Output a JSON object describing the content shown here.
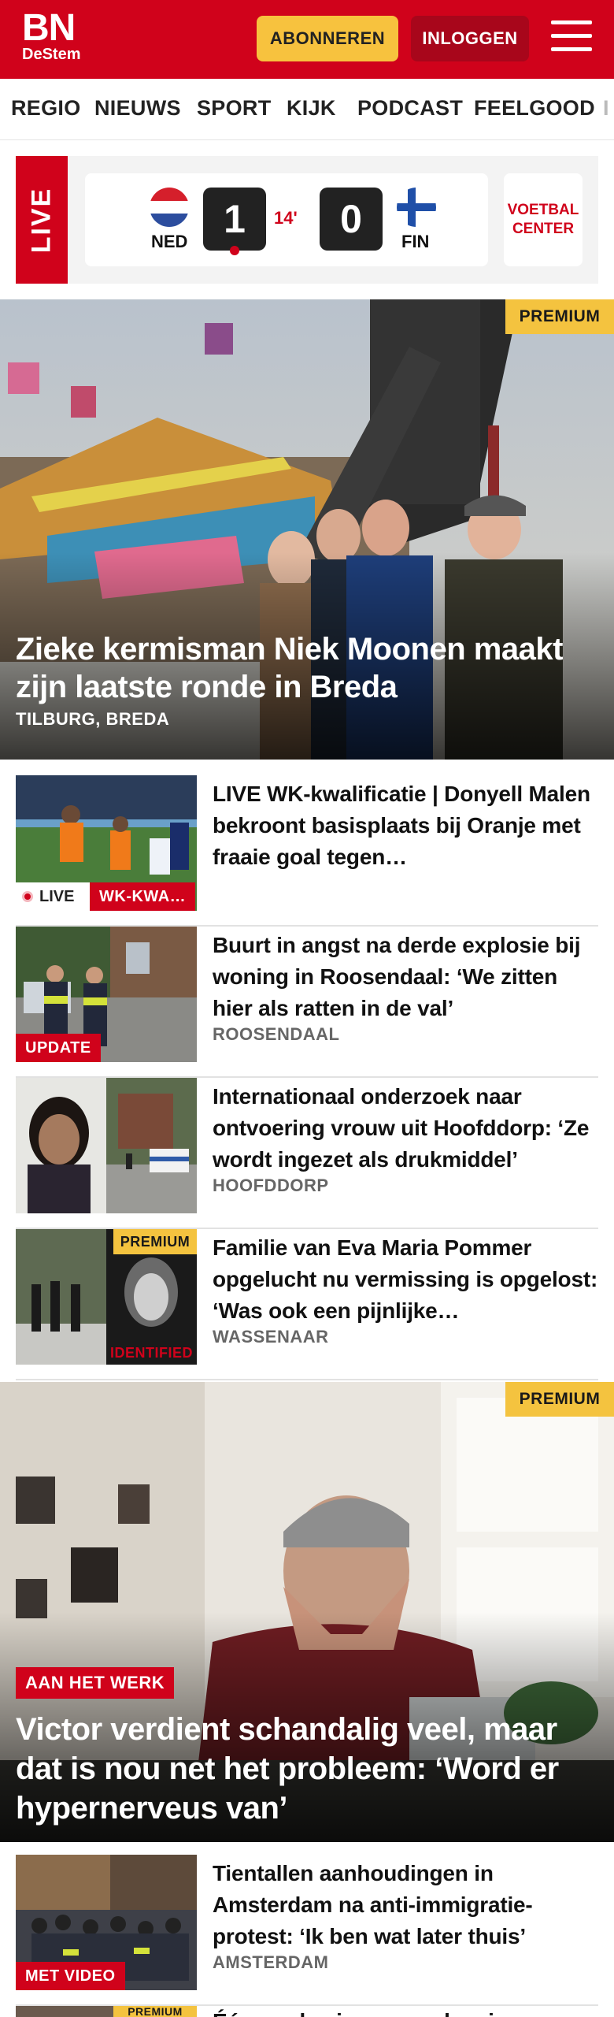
{
  "header": {
    "logo_top": "BN",
    "logo_bottom": "DeStem",
    "subscribe_label": "ABONNEREN",
    "login_label": "INLOGGEN",
    "colors": {
      "brand": "#d0021b",
      "subscribe": "#f7c23e",
      "login": "#a8061b"
    }
  },
  "nav": {
    "items": [
      {
        "label": "REGIO"
      },
      {
        "label": "NIEUWS"
      },
      {
        "label": "SPORT"
      },
      {
        "label": "KIJK"
      },
      {
        "label": "PODCAST"
      },
      {
        "label": "FEELGOOD"
      },
      {
        "label": "I"
      }
    ]
  },
  "live_match": {
    "tag": "LIVE",
    "home": {
      "code": "NED",
      "score": "1"
    },
    "away": {
      "code": "FIN",
      "score": "0"
    },
    "minute": "14'",
    "voetbal_center": "VOETBAL CENTER"
  },
  "hero": {
    "badge": "PREMIUM",
    "title": "Zieke kermisman Niek Moonen maakt zijn laatste ronde in Breda",
    "location": "TILBURG, BREDA"
  },
  "articles": [
    {
      "title": "LIVE WK-kwalificatie | Donyell Malen bekroont basisplaats bij Oranje met fraaie goal tegen…",
      "live_label": "LIVE",
      "tag": "WK-KWA…",
      "location": ""
    },
    {
      "title": "Buurt in angst na derde explosie bij woning in Roosendaal: ‘We zitten hier als ratten in de val’",
      "tag": "UPDATE",
      "location": "ROOSENDAAL"
    },
    {
      "title": "Internationaal onderzoek naar ontvoering vrouw uit Hoofddorp: ‘Ze wordt ingezet als drukmiddel’",
      "tag": "",
      "location": "HOOFDDORP"
    },
    {
      "title": "Familie van Eva Maria Pommer opgelucht nu vermissing is opgelost: ‘Was ook een pijnlijke…",
      "badge": "PREMIUM",
      "thumb_text": "IDENTIFIED",
      "location": "WASSENAAR"
    }
  ],
  "feature": {
    "badge": "PREMIUM",
    "tag": "AAN HET WERK",
    "title": "Victor verdient schandalig veel, maar dat is nou net het probleem: ‘Word er hypernerveus van’"
  },
  "article_bottom": {
    "title": "Tientallen aanhoudingen in Amsterdam na anti-immigratie-protest: ‘Ik ben wat later thuis’",
    "tag": "MET VIDEO",
    "location": "AMSTERDAM"
  },
  "article_cutoff": {
    "badge": "PREMIUM",
    "title": "Één op de vier waarschuwingen"
  }
}
